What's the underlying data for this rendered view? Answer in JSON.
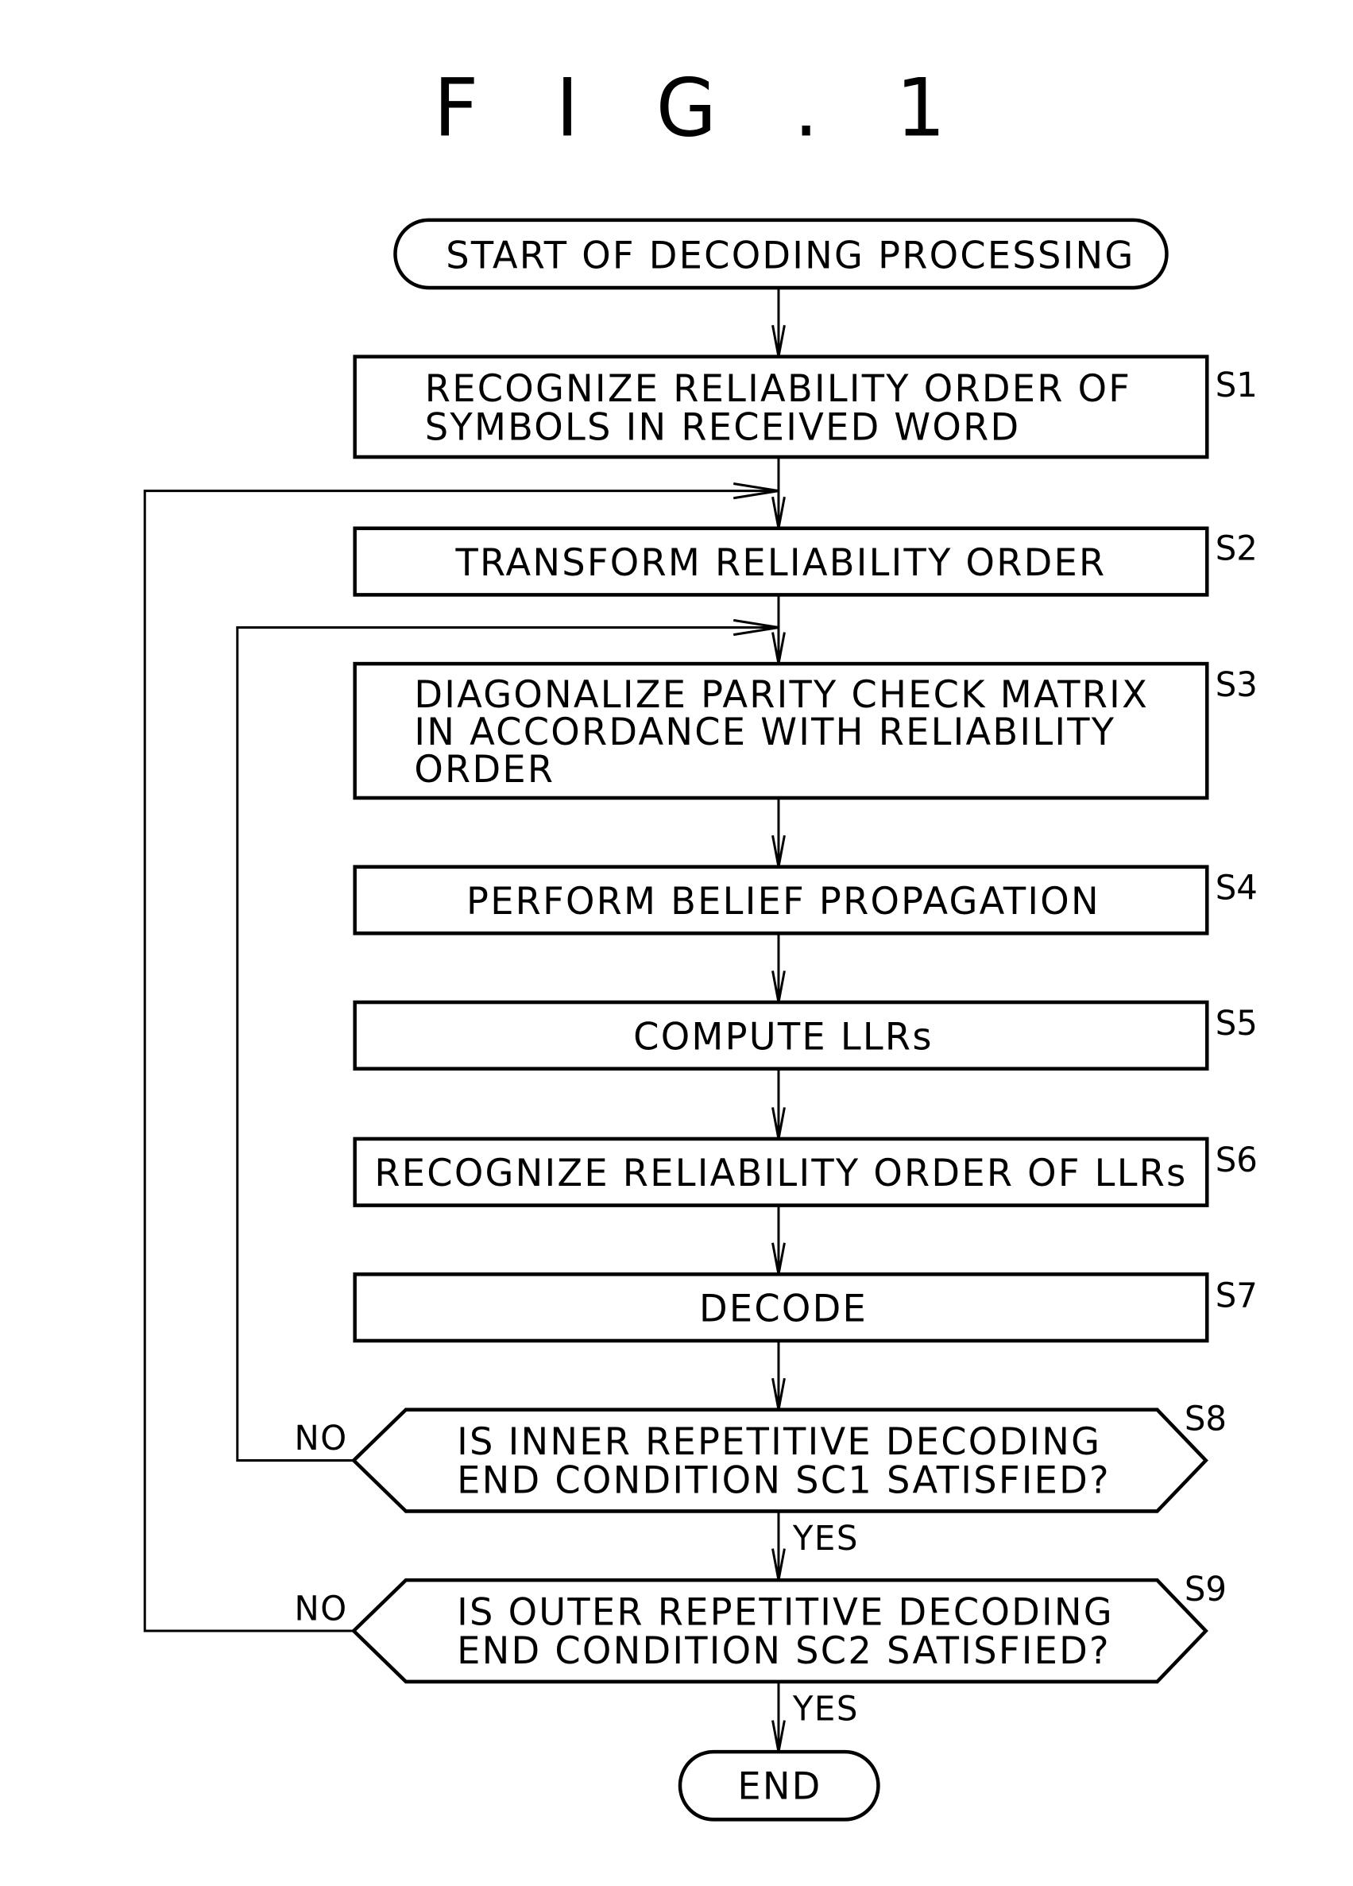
{
  "figure": {
    "title": "F I G . 1"
  },
  "flowchart": {
    "start": {
      "label": "START OF DECODING PROCESSING"
    },
    "steps": [
      {
        "id": "S1",
        "lines": [
          "RECOGNIZE RELIABILITY ORDER OF",
          "SYMBOLS IN RECEIVED WORD"
        ]
      },
      {
        "id": "S2",
        "lines": [
          "TRANSFORM RELIABILITY ORDER"
        ]
      },
      {
        "id": "S3",
        "lines": [
          "DIAGONALIZE PARITY CHECK MATRIX",
          "IN ACCORDANCE WITH RELIABILITY",
          "ORDER"
        ]
      },
      {
        "id": "S4",
        "lines": [
          "PERFORM BELIEF PROPAGATION"
        ]
      },
      {
        "id": "S5",
        "lines": [
          "COMPUTE LLRs"
        ]
      },
      {
        "id": "S6",
        "lines": [
          "RECOGNIZE RELIABILITY ORDER OF LLRs"
        ]
      },
      {
        "id": "S7",
        "lines": [
          "DECODE"
        ]
      }
    ],
    "decisions": [
      {
        "id": "S8",
        "lines": [
          "IS INNER REPETITIVE DECODING",
          "END CONDITION SC1 SATISFIED?"
        ],
        "no_label": "NO",
        "yes_label": "YES"
      },
      {
        "id": "S9",
        "lines": [
          "IS OUTER REPETITIVE DECODING",
          "END CONDITION SC2 SATISFIED?"
        ],
        "no_label": "NO",
        "yes_label": "YES"
      }
    ],
    "end": {
      "label": "END"
    }
  }
}
